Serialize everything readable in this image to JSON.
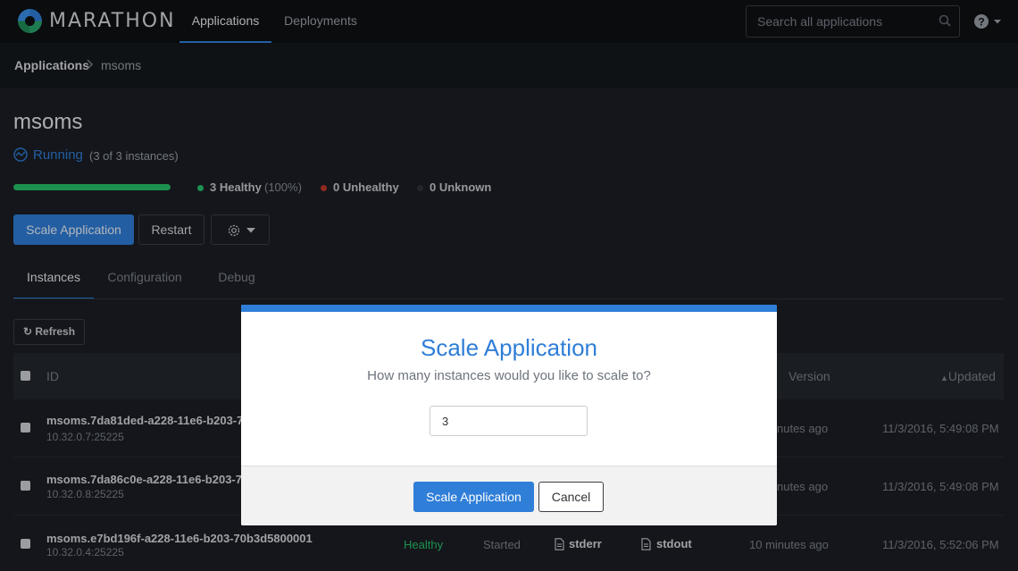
{
  "nav": {
    "brand": "MARATHON",
    "tabs": [
      "Applications",
      "Deployments"
    ],
    "search_placeholder": "Search all applications"
  },
  "breadcrumb": {
    "root": "Applications",
    "current": "msoms"
  },
  "app": {
    "name": "msoms",
    "status": "Running",
    "instances_summary": "(3 of 3 instances)",
    "health_fraction": 1.0,
    "healthy_label": "3 Healthy",
    "healthy_pct": "(100%)",
    "unhealthy_label": "0 Unhealthy",
    "unknown_label": "0 Unknown",
    "actions": {
      "scale": "Scale Application",
      "restart": "Restart"
    }
  },
  "tabs": [
    "Instances",
    "Configuration",
    "Debug"
  ],
  "refresh_label": "Refresh",
  "table": {
    "headers": {
      "id": "ID",
      "version": "Version",
      "updated": "Updated"
    },
    "rows": [
      {
        "id": "msoms.7da81ded-a228-11e6-b203-70",
        "host": "10.32.0.7:25225",
        "version": "nutes ago",
        "updated": "11/3/2016, 5:49:08 PM"
      },
      {
        "id": "msoms.7da86c0e-a228-11e6-b203-70",
        "host": "10.32.0.8:25225",
        "version": "nutes ago",
        "updated": "11/3/2016, 5:49:08 PM"
      },
      {
        "id": "msoms.e7bd196f-a228-11e6-b203-70b3d5800001",
        "host": "10.32.0.4:25225",
        "health": "Healthy",
        "status": "Started",
        "stderr": "stderr",
        "stdout": "stdout",
        "version": "10 minutes ago",
        "updated": "11/3/2016, 5:52:06 PM"
      }
    ]
  },
  "modal": {
    "title": "Scale Application",
    "question": "How many instances would you like to scale to?",
    "value": "3",
    "confirm": "Scale Application",
    "cancel": "Cancel"
  },
  "colors": {
    "accent": "#2f7ed8",
    "healthy": "#27c06a",
    "unhealthy": "#c0392b",
    "unknown": "#2e3238"
  }
}
